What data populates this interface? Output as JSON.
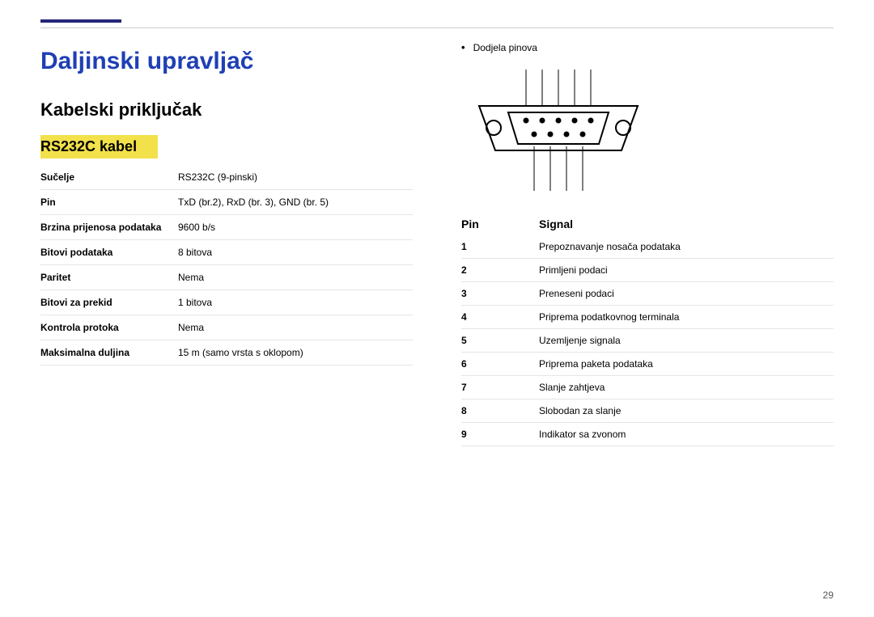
{
  "page": {
    "title": "Daljinski upravljač",
    "subtitle": "Kabelski priključak",
    "cable_heading": "RS232C kabel",
    "page_number": "29"
  },
  "specs": [
    {
      "label": "Sučelje",
      "value": "RS232C (9-pinski)"
    },
    {
      "label": "Pin",
      "value": "TxD (br.2), RxD (br. 3), GND (br. 5)"
    },
    {
      "label": "Brzina prijenosa podataka",
      "value": "9600 b/s"
    },
    {
      "label": "Bitovi podataka",
      "value": "8 bitova"
    },
    {
      "label": "Paritet",
      "value": "Nema"
    },
    {
      "label": "Bitovi za prekid",
      "value": "1 bitova"
    },
    {
      "label": "Kontrola protoka",
      "value": "Nema"
    },
    {
      "label": "Maksimalna duljina",
      "value": "15 m (samo vrsta s oklopom)"
    }
  ],
  "right": {
    "bullet": "•",
    "list_title": "Dodjela pinova"
  },
  "pin_header": {
    "a": "Pin",
    "b": "Signal"
  },
  "pins": [
    {
      "n": "1",
      "sig": "Prepoznavanje nosača podataka"
    },
    {
      "n": "2",
      "sig": "Primljeni podaci"
    },
    {
      "n": "3",
      "sig": "Preneseni podaci"
    },
    {
      "n": "4",
      "sig": "Priprema podatkovnog terminala"
    },
    {
      "n": "5",
      "sig": "Uzemljenje signala"
    },
    {
      "n": "6",
      "sig": "Priprema paketa podataka"
    },
    {
      "n": "7",
      "sig": "Slanje zahtjeva"
    },
    {
      "n": "8",
      "sig": "Slobodan za slanje"
    },
    {
      "n": "9",
      "sig": "Indikator sa zvonom"
    }
  ]
}
